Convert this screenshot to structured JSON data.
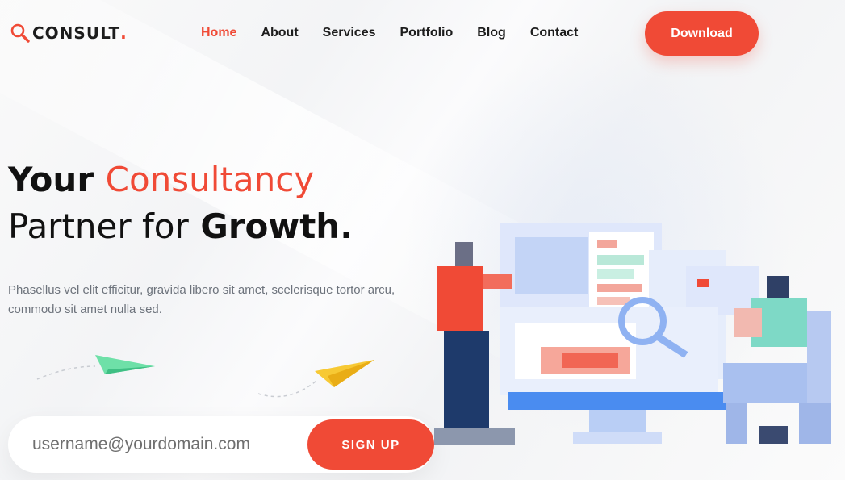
{
  "brand": {
    "name": "CONSULT",
    "dot": ".",
    "icon": "magnifier-icon",
    "accent": "#f04a36"
  },
  "nav": {
    "items": [
      {
        "label": "Home",
        "active": true
      },
      {
        "label": "About",
        "active": false
      },
      {
        "label": "Services",
        "active": false
      },
      {
        "label": "Portfolio",
        "active": false
      },
      {
        "label": "Blog",
        "active": false
      },
      {
        "label": "Contact",
        "active": false
      }
    ]
  },
  "header": {
    "download_label": "Download"
  },
  "hero": {
    "line1_word1": "Your",
    "line1_word2": "Consultancy",
    "line2_word1": "Partner for",
    "line2_word2": "Growth.",
    "description": "Phasellus vel elit efficitur, gravida libero sit amet, scelerisque tortor arcu, commodo sit amet nulla sed."
  },
  "signup": {
    "placeholder": "username@yourdomain.com",
    "button_label": "SIGN UP"
  },
  "colors": {
    "primary": "#f04a36",
    "text_dark": "#111111",
    "text_muted": "#6d737c",
    "plane_green": "#6ee0a8",
    "plane_yellow": "#f7c934",
    "illustration_blue": "#4a8cf0"
  }
}
